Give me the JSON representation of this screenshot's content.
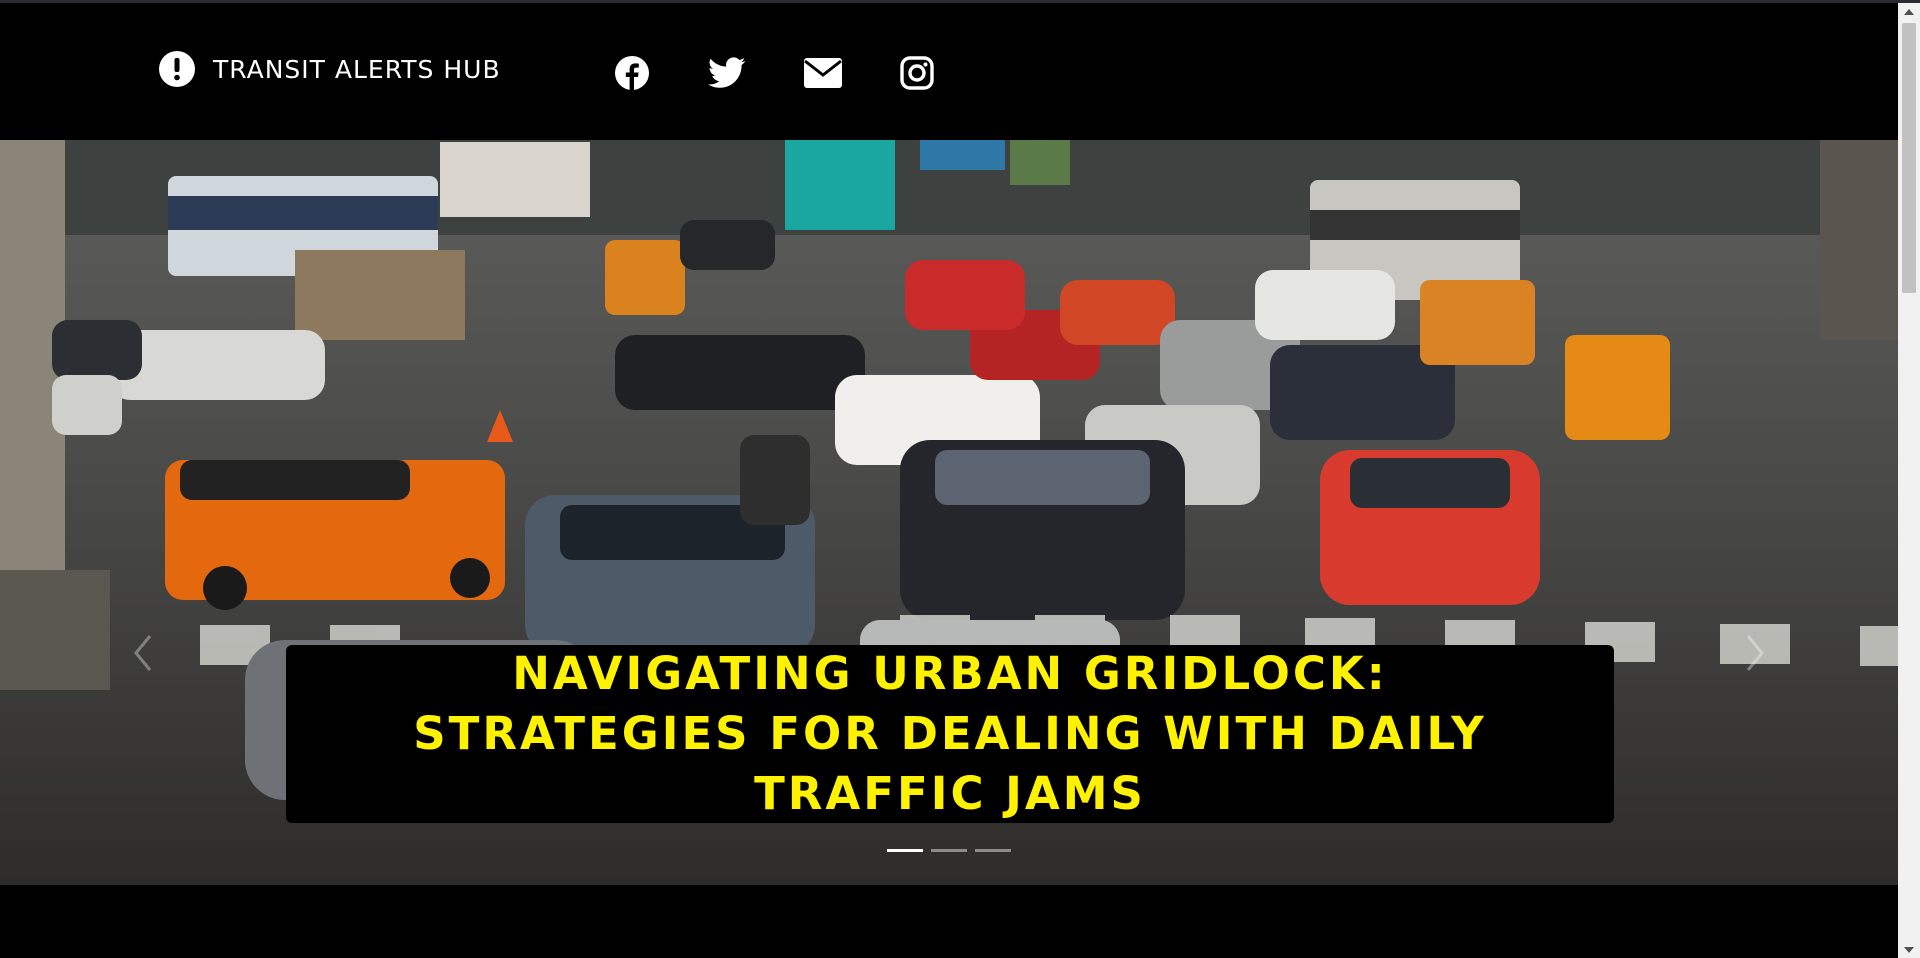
{
  "header": {
    "brand": "TRANSIT ALERTS HUB",
    "brand_icon": "alert-circle-icon",
    "social": [
      {
        "name": "facebook-icon"
      },
      {
        "name": "twitter-icon"
      },
      {
        "name": "envelope-icon"
      },
      {
        "name": "instagram-icon"
      }
    ]
  },
  "hero": {
    "title": "NAVIGATING URBAN GRIDLOCK: STRATEGIES FOR DEALING WITH DAILY TRAFFIC JAMS",
    "slide_count": 3,
    "active_slide": 1,
    "prev_icon": "chevron-left-icon",
    "next_icon": "chevron-right-icon"
  },
  "colors": {
    "background": "#000000",
    "title_text": "#fff200",
    "header_text": "#ffffff"
  }
}
